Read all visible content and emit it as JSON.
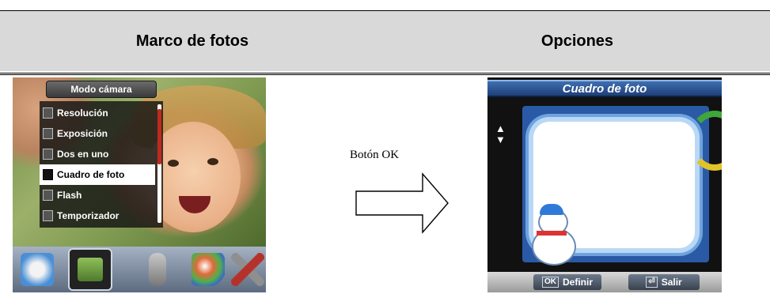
{
  "header": {
    "left_title": "Marco de fotos",
    "right_title": "Opciones"
  },
  "camera_menu": {
    "title": "Modo cámara",
    "items": [
      {
        "label": "Resolución",
        "icon": "resolution-icon",
        "selected": false
      },
      {
        "label": "Exposición",
        "icon": "exposure-icon",
        "selected": false
      },
      {
        "label": "Dos en uno",
        "icon": "two-in-one-icon",
        "selected": false
      },
      {
        "label": "Cuadro de foto",
        "icon": "photo-frame-icon",
        "selected": true
      },
      {
        "label": "Flash",
        "icon": "flash-icon",
        "selected": false
      },
      {
        "label": "Temporizador",
        "icon": "timer-icon",
        "selected": false
      }
    ],
    "tray_icons": [
      "video-mode-icon",
      "camera-mode-icon",
      "voice-record-icon",
      "palette-icon",
      "tools-icon"
    ]
  },
  "transition": {
    "label": "Botón OK"
  },
  "option_screen": {
    "title": "Cuadro de foto",
    "nav_symbols": [
      "▲",
      "▼"
    ],
    "footer": {
      "define_key": "OK",
      "define_label": "Definir",
      "exit_key": "⏎",
      "exit_label": "Salir"
    }
  }
}
